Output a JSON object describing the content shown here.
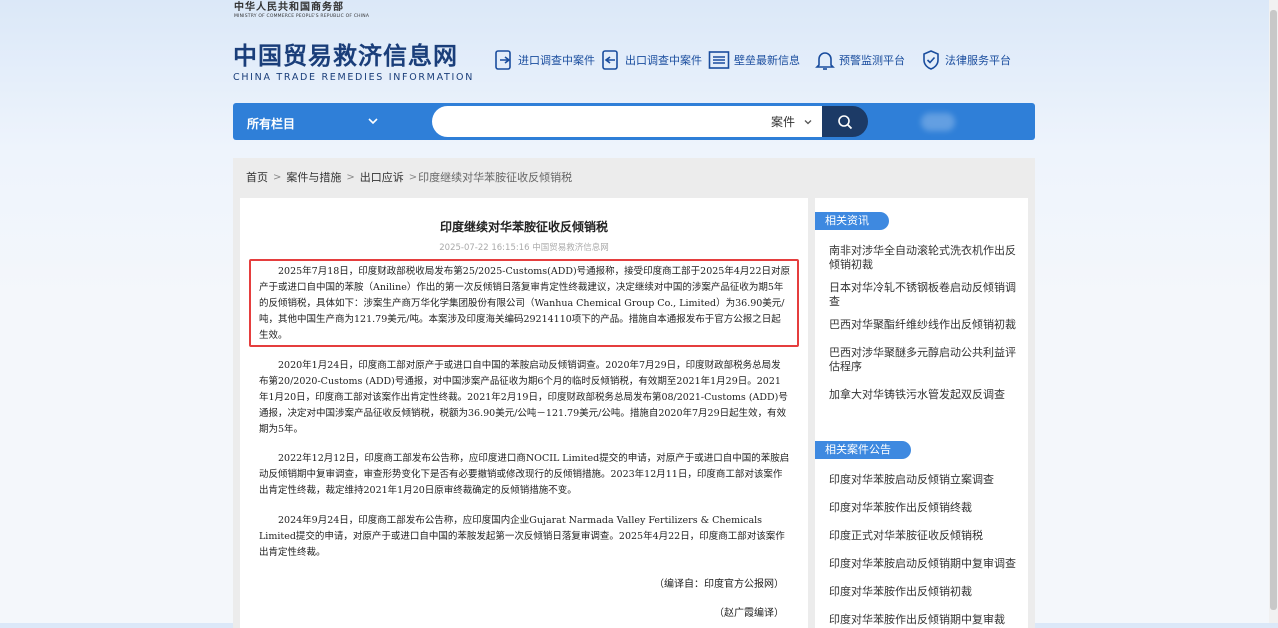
{
  "header": {
    "ministry_cn": "中华人民共和国商务部",
    "ministry_en": "MINISTRY OF COMMERCE PEOPLE'S REPUBLIC OF CHINA",
    "site_cn": "中国贸易救济信息网",
    "site_en": "CHINA TRADE REMEDIES INFORMATION",
    "nav": [
      "进口调查中案件",
      "出口调查中案件",
      "壁垒最新信息",
      "预警监测平台",
      "法律服务平台"
    ]
  },
  "search": {
    "scope_label": "所有栏目",
    "type_label": "案件",
    "placeholder": ""
  },
  "breadcrumb": [
    "首页",
    "案件与措施",
    "出口应诉",
    "印度继续对华苯胺征收反倾销税"
  ],
  "article": {
    "title": "印度继续对华苯胺征收反倾销税",
    "meta": "2025-07-22 16:15:16 中国贸易救济信息网",
    "paragraphs": [
      "2025年7月18日，印度财政部税收局发布第25/2025-Customs(ADD)号通报称，接受印度商工部于2025年4月22日对原产于或进口自中国的苯胺（Aniline）作出的第一次反倾销日落复审肯定性终裁建议，决定继续对中国的涉案产品征收为期5年的反倾销税，具体如下：涉案生产商万华化学集团股份有限公司（Wanhua Chemical Group Co., Limited）为36.90美元/吨，其他中国生产商为121.79美元/吨。本案涉及印度海关编码29214110项下的产品。措施自本通报发布于官方公报之日起生效。",
      "2020年1月24日，印度商工部对原产于或进口自中国的苯胺启动反倾销调查。2020年7月29日，印度财政部税务总局发布第20/2020-Customs (ADD)号通报，对中国涉案产品征收为期6个月的临时反倾销税，有效期至2021年1月29日。2021年1月20日，印度商工部对该案作出肯定性终裁。2021年2月19日，印度财政部税务总局发布第08/2021-Customs (ADD)号通报，决定对中国涉案产品征收反倾销税，税额为36.90美元/公吨－121.79美元/公吨。措施自2020年7月29日起生效，有效期为5年。",
      "2022年12月12日，印度商工部发布公告称，应印度进口商NOCIL Limited提交的申请，对原产于或进口自中国的苯胺启动反倾销期中复审调查，审查形势变化下是否有必要撤销或修改现行的反倾销措施。2023年12月11日，印度商工部对该案作出肯定性终裁，裁定维持2021年1月20日原审终裁确定的反倾销措施不变。",
      "2024年9月24日，印度商工部发布公告称，应印度国内企业Gujarat Narmada Valley Fertilizers & Chemicals Limited提交的申请，对原产于或进口自中国的苯胺发起第一次反倾销日落复审调查。2025年4月22日，印度商工部对该案作出肯定性终裁。"
    ],
    "source_note": "（编译自：印度官方公报网）",
    "editor_note": "（赵广霞编译）"
  },
  "sidebar": {
    "related_news_title": "相关资讯",
    "related_news": [
      "南非对涉华全自动滚轮式洗衣机作出反倾销初裁",
      "日本对华冷轧不锈钢板卷启动反倾销调查",
      "巴西对华聚酯纤维纱线作出反倾销初裁",
      "巴西对涉华聚醚多元醇启动公共利益评估程序",
      "加拿大对华铸铁污水管发起双反调查"
    ],
    "related_cases_title": "相关案件公告",
    "related_cases": [
      "印度对华苯胺启动反倾销立案调查",
      "印度对华苯胺作出反倾销终裁",
      "印度正式对华苯胺征收反倾销税",
      "印度对华苯胺启动反倾销期中复审调查",
      "印度对华苯胺作出反倾销初裁",
      "印度对华苯胺作出反倾销期中复审裁"
    ]
  },
  "colors": {
    "brand_blue": "#2f7fd8",
    "search_button": "#1c3a66",
    "highlight_border": "#e53e3e",
    "tag_blue": "#3e89e0",
    "title_navy": "#1a3e7a"
  },
  "icons": [
    "import-case-icon",
    "export-case-icon",
    "barrier-icon",
    "bell-icon",
    "shield-icon",
    "search-icon",
    "chevron-down-icon"
  ]
}
